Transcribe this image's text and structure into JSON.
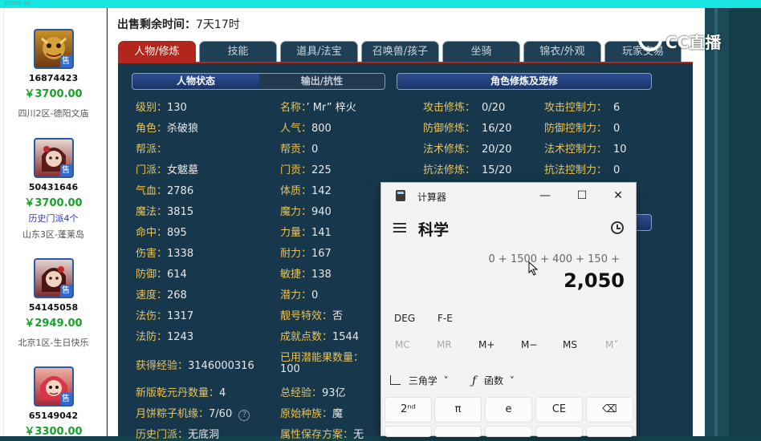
{
  "topbar_text": "35B85.36",
  "listings": [
    {
      "id": "16874423",
      "price": "￥3700.00",
      "extra": "",
      "server": "四川2区-德阳文庙",
      "badge": "售"
    },
    {
      "id": "50431646",
      "price": "￥3700.00",
      "extra": "历史门派4个",
      "server": "山东3区-蓬莱岛",
      "badge": "售"
    },
    {
      "id": "54145058",
      "price": "￥2949.00",
      "extra": "",
      "server": "北京1区-生日快乐",
      "badge": "售"
    },
    {
      "id": "65149042",
      "price": "￥3300.00",
      "extra": "",
      "server": "",
      "badge": "售"
    }
  ],
  "sale_time": {
    "label": "出售剩余时间：",
    "value": "7天17时"
  },
  "tabs": [
    "人物/修炼",
    "技能",
    "道具/法宝",
    "召唤兽/孩子",
    "坐骑",
    "锦衣/外观",
    "玩家交易"
  ],
  "subheaders": {
    "status": "人物状态",
    "output": "输出/抗性",
    "cultivation": "角色修炼及宠修"
  },
  "stats_col1": [
    {
      "label": "级别：",
      "value": "130"
    },
    {
      "label": "角色：",
      "value": "杀破狼"
    },
    {
      "label": "帮派：",
      "value": ""
    },
    {
      "label": "门派：",
      "value": "女魃墓"
    },
    {
      "label": "气血：",
      "value": "2786"
    },
    {
      "label": "魔法：",
      "value": "3815"
    },
    {
      "label": "命中：",
      "value": "895"
    },
    {
      "label": "伤害：",
      "value": "1338"
    },
    {
      "label": "防御：",
      "value": "614"
    },
    {
      "label": "速度：",
      "value": "268"
    },
    {
      "label": "法伤：",
      "value": "1317"
    },
    {
      "label": "法防：",
      "value": "1243"
    }
  ],
  "stats_col2": [
    {
      "label": "名称：",
      "value": "’ Mr” 梓火"
    },
    {
      "label": "人气：",
      "value": "800"
    },
    {
      "label": "帮贡：",
      "value": "0"
    },
    {
      "label": "门贡：",
      "value": "225"
    },
    {
      "label": "体质：",
      "value": "142"
    },
    {
      "label": "魔力：",
      "value": "940"
    },
    {
      "label": "力量：",
      "value": "141"
    },
    {
      "label": "耐力：",
      "value": "167"
    },
    {
      "label": "敏捷：",
      "value": "138"
    },
    {
      "label": "潜力：",
      "value": "0"
    },
    {
      "label": "靓号特效：",
      "value": "否"
    },
    {
      "label": "成就点数：",
      "value": "1544"
    }
  ],
  "stats_extra": {
    "exp_label": "获得经验：",
    "exp_value": "3146000316",
    "used_label": "已用潜能果数量：",
    "used_value": "100",
    "qian_label": "新版乾元丹数量：",
    "qian_value": "4",
    "total_label": "总经验：",
    "total_value": "93亿",
    "moon_label": "月饼粽子机缘：",
    "moon_value": "7/60",
    "race_label": "原始种族：",
    "race_value": "魔",
    "hist_label": "历史门派：",
    "hist_value": "无底洞",
    "attr_label": "属性保存方案：",
    "attr_value": "无"
  },
  "cultivation": [
    {
      "label": "攻击修炼：",
      "value": "0/20",
      "label2": "攻击控制力：",
      "value2": "6"
    },
    {
      "label": "防御修炼：",
      "value": "16/20",
      "label2": "防御控制力：",
      "value2": "0"
    },
    {
      "label": "法术修炼：",
      "value": "20/20",
      "label2": "法术控制力：",
      "value2": "10"
    },
    {
      "label": "抗法修炼：",
      "value": "15/20",
      "label2": "抗法控制力：",
      "value2": "0"
    }
  ],
  "logo_text": "CC直播",
  "calculator": {
    "title": "计算器",
    "mode": "科学",
    "expression": "0 + 1500 + 400 + 150 +",
    "result": "2,050",
    "deg": "DEG",
    "fe": "F-E",
    "memory": [
      "MC",
      "MR",
      "M+",
      "M−",
      "MS",
      "M˅"
    ],
    "trig": "三角学",
    "func": "函数",
    "keys": [
      "2ⁿᵈ",
      "π",
      "e",
      "CE",
      "⌫"
    ],
    "controls": {
      "minimize": "—",
      "maximize": "☐",
      "close": "✕"
    }
  }
}
